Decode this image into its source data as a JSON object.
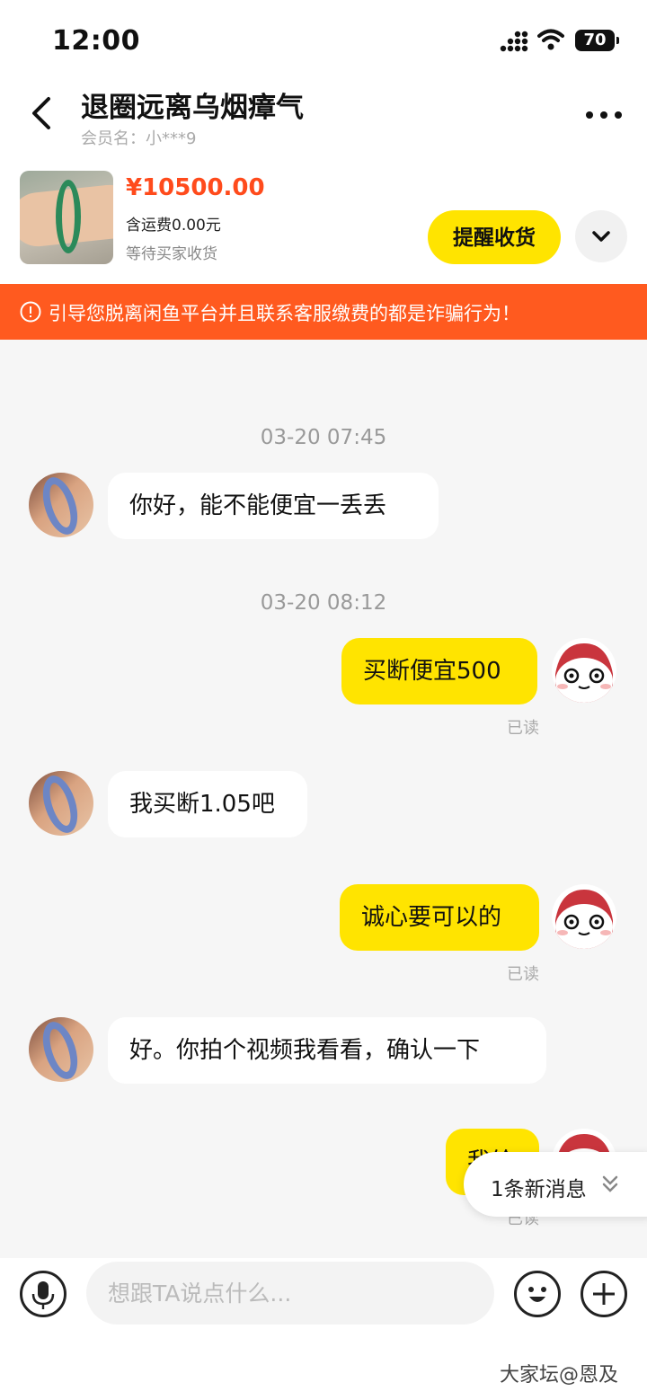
{
  "status_bar": {
    "time": "12:00",
    "battery": "70"
  },
  "header": {
    "title": "退圈远离乌烟瘴气",
    "member": "会员名：小***9"
  },
  "product": {
    "price": "¥10500.00",
    "shipping": "含运费0.00元",
    "status": "等待买家收货",
    "remind_label": "提醒收货"
  },
  "warning": {
    "text": "引导您脱离闲鱼平台并且联系客服缴费的都是诈骗行为！"
  },
  "chat": {
    "timestamps": [
      "03-20 07:45",
      "03-20 08:12"
    ],
    "messages": [
      {
        "from": "buyer",
        "text": "你好，能不能便宜一丢丢"
      },
      {
        "from": "seller",
        "text": "买断便宜500",
        "status": "已读"
      },
      {
        "from": "buyer",
        "text": "我买断1.05吧"
      },
      {
        "from": "seller",
        "text": "诚心要可以的",
        "status": "已读"
      },
      {
        "from": "buyer",
        "text": "好。你拍个视频我看看，确认一下"
      },
      {
        "from": "seller",
        "text": "我给",
        "status": "已读"
      }
    ],
    "new_message": "1条新消息"
  },
  "input": {
    "placeholder": "想跟TA说点什么..."
  },
  "watermark": "大家坛@恩及",
  "colors": {
    "accent_yellow": "#ffe400",
    "price_red": "#ff4b1c",
    "warning_orange": "#ff5a1f"
  }
}
